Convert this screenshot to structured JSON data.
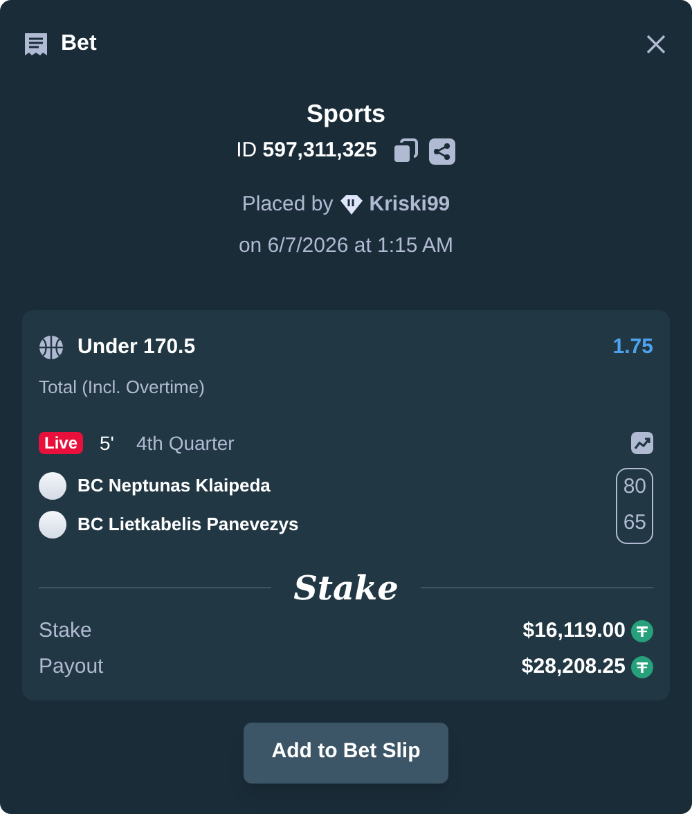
{
  "header": {
    "title": "Bet"
  },
  "summary": {
    "category": "Sports",
    "id_label": "ID",
    "id_value": "597,311,325",
    "placed_by": "Placed by",
    "user": "Kriski99",
    "placed_on": "on 6/7/2026 at 1:15 AM"
  },
  "bet": {
    "selection": "Under 170.5",
    "odds": "1.75",
    "market": "Total (Incl. Overtime)",
    "live": true,
    "live_label": "Live",
    "minute": "5'",
    "period": "4th Quarter",
    "teams": [
      {
        "name": "BC Neptunas Klaipeda",
        "score": "80"
      },
      {
        "name": "BC Lietkabelis Panevezys",
        "score": "65"
      }
    ],
    "brand": "Stake",
    "amounts": [
      {
        "label": "Stake",
        "value": "$16,119.00"
      },
      {
        "label": "Payout",
        "value": "$28,208.25"
      }
    ]
  },
  "action": {
    "label": "Add to Bet Slip"
  }
}
